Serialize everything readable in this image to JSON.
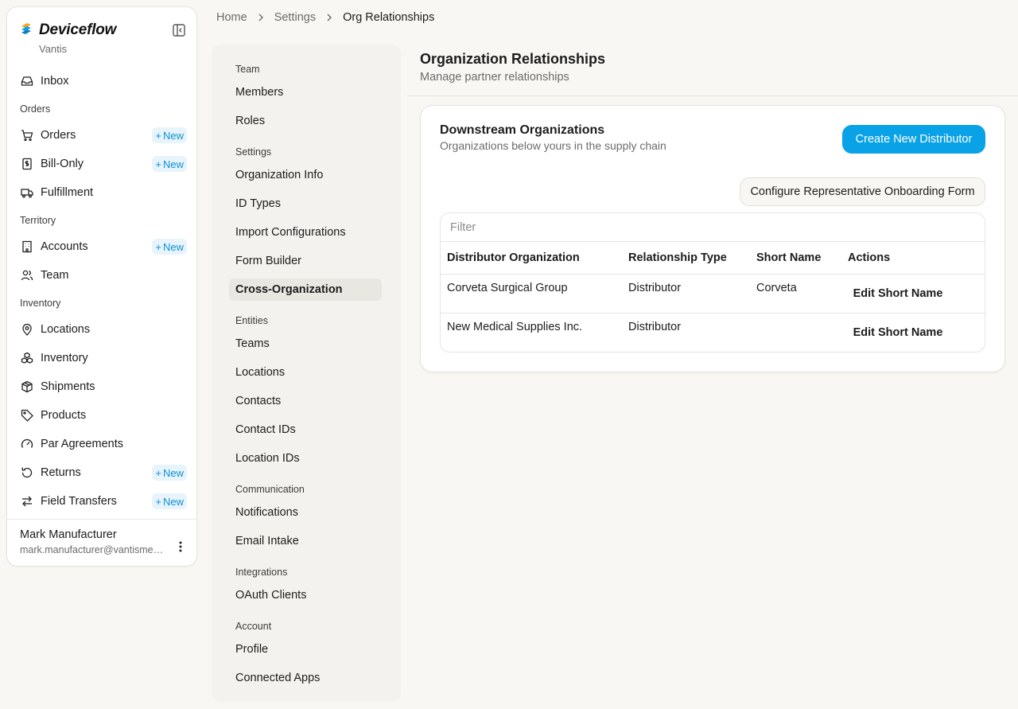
{
  "app": {
    "brand": "Deviceflow",
    "org": "Vantis"
  },
  "sidebar": {
    "top_items": [
      {
        "label": "Inbox",
        "icon": "inbox-icon"
      }
    ],
    "sections": [
      {
        "title": "Orders",
        "items": [
          {
            "label": "Orders",
            "icon": "cart-icon",
            "badge": "New"
          },
          {
            "label": "Bill-Only",
            "icon": "receipt-icon",
            "badge": "New"
          },
          {
            "label": "Fulfillment",
            "icon": "truck-icon"
          }
        ]
      },
      {
        "title": "Territory",
        "items": [
          {
            "label": "Accounts",
            "icon": "building-icon",
            "badge": "New"
          },
          {
            "label": "Team",
            "icon": "users-icon"
          }
        ]
      },
      {
        "title": "Inventory",
        "items": [
          {
            "label": "Locations",
            "icon": "map-pin-icon"
          },
          {
            "label": "Inventory",
            "icon": "boxes-icon"
          },
          {
            "label": "Shipments",
            "icon": "package-icon"
          },
          {
            "label": "Products",
            "icon": "tag-icon"
          },
          {
            "label": "Par Agreements",
            "icon": "gauge-icon"
          },
          {
            "label": "Returns",
            "icon": "rotate-icon",
            "badge": "New"
          },
          {
            "label": "Field Transfers",
            "icon": "arrows-swap-icon",
            "badge": "New"
          }
        ]
      }
    ],
    "user": {
      "name": "Mark Manufacturer",
      "email": "mark.manufacturer@vantismedical.com"
    }
  },
  "breadcrumb": [
    "Home",
    "Settings",
    "Org Relationships"
  ],
  "settings_nav": [
    {
      "section": "Team",
      "items": [
        "Members",
        "Roles"
      ]
    },
    {
      "section": "Settings",
      "items": [
        "Organization Info",
        "ID Types",
        "Import Configurations",
        "Form Builder",
        "Cross-Organization"
      ]
    },
    {
      "section": "Entities",
      "items": [
        "Teams",
        "Locations",
        "Contacts",
        "Contact IDs",
        "Location IDs"
      ]
    },
    {
      "section": "Communication",
      "items": [
        "Notifications",
        "Email Intake"
      ]
    },
    {
      "section": "Integrations",
      "items": [
        "OAuth Clients"
      ]
    },
    {
      "section": "Account",
      "items": [
        "Profile",
        "Connected Apps"
      ]
    }
  ],
  "settings_nav_active": "Cross-Organization",
  "page": {
    "title": "Organization Relationships",
    "subtitle": "Manage partner relationships"
  },
  "card": {
    "title": "Downstream Organizations",
    "subtitle": "Organizations below yours in the supply chain",
    "create_button": "Create New Distributor",
    "configure_button": "Configure Representative Onboarding Form",
    "filter_placeholder": "Filter",
    "columns": [
      "Distributor Organization",
      "Relationship Type",
      "Short Name",
      "Actions"
    ],
    "rows": [
      {
        "org": "Corveta Surgical Group",
        "type": "Distributor",
        "short": "Corveta",
        "action": "Edit Short Name"
      },
      {
        "org": "New Medical Supplies Inc.",
        "type": "Distributor",
        "short": "",
        "action": "Edit Short Name"
      }
    ]
  },
  "colors": {
    "accent": "#0aa2e6",
    "badge_bg": "#e8f4fb",
    "badge_text": "#0b8fd4",
    "page_bg": "#f8f7f3"
  }
}
